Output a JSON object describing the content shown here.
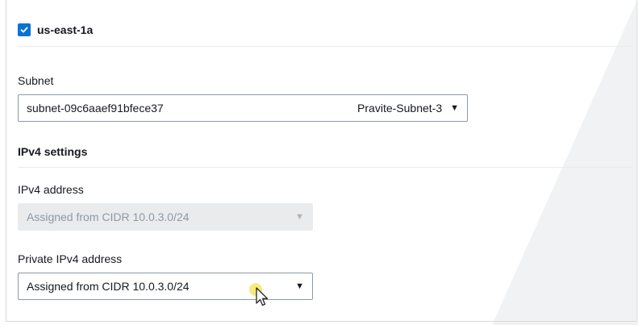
{
  "availability_zone": {
    "label": "us-east-1a",
    "checked": true,
    "accent": "#0972d3"
  },
  "subnet": {
    "label": "Subnet",
    "value": "subnet-09c6aaef91bfece37",
    "secondary": "Pravite-Subnet-3",
    "caret": "▼"
  },
  "ipv4_settings": {
    "title": "IPv4 settings",
    "ipv4_address": {
      "label": "IPv4 address",
      "value": "Assigned from CIDR 10.0.3.0/24",
      "caret": "▼",
      "disabled": true
    },
    "private_ipv4_address": {
      "label": "Private IPv4 address",
      "value": "Assigned from CIDR 10.0.3.0/24",
      "caret": "▼"
    }
  },
  "icons": {
    "checkbox": "check-icon",
    "cursor": "mouse-pointer-icon"
  }
}
